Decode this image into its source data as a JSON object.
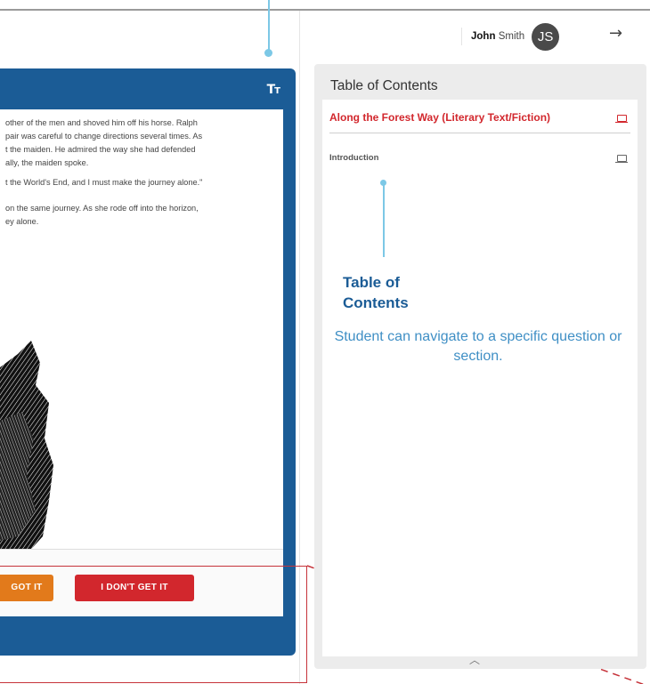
{
  "reader": {
    "font_size_icon": "Tт",
    "passage_lines": [
      "other of the men and shoved him off his horse. Ralph",
      "pair was careful to change directions several times. As",
      "t the maiden. He admired the way she had defended",
      "ally, the maiden spoke.",
      "t the World's End, and I must make the journey alone.\"",
      "on the same journey. As she rode off into the horizon,",
      "ey alone."
    ],
    "buttons": {
      "got_it": "I GOT IT",
      "got_it_visible": "GOT IT",
      "dont_get_it": "I DON'T GET IT"
    }
  },
  "user": {
    "first_name": "John",
    "last_name": "Smith",
    "initials": "JS"
  },
  "toc": {
    "title": "Table of Contents",
    "items": [
      {
        "label": "Along the Forest Way (Literary Text/Fiction)",
        "active": true
      },
      {
        "label": "Introduction",
        "active": false
      }
    ]
  },
  "annotation": {
    "title": "Table of Contents",
    "description": "Student can navigate to a specific question or section."
  },
  "colors": {
    "reader_blue": "#1b5c96",
    "got_it_orange": "#e27a1b",
    "dont_get_it_red": "#d2272d",
    "callout_blue": "#7cc8e6"
  }
}
